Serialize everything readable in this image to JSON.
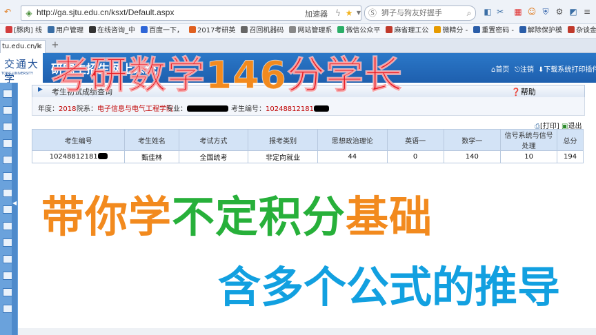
{
  "browser": {
    "url": "http://ga.sjtu.edu.cn/ksxt/Default.aspx",
    "accelerator": "加速器",
    "search_placeholder": "狮子与狗友好握手",
    "bookmarks": [
      {
        "label": "[豚肉] 线",
        "color": "#d23c3c"
      },
      {
        "label": "用户管理",
        "color": "#3a6ea5"
      },
      {
        "label": "在线咨询_中",
        "color": "#333333"
      },
      {
        "label": "百度一下，",
        "color": "#2e66d8"
      },
      {
        "label": "2017考研英",
        "color": "#e06020"
      },
      {
        "label": "召回机器码",
        "color": "#666666"
      },
      {
        "label": "网站管理系",
        "color": "#888888"
      },
      {
        "label": "微信公众平",
        "color": "#2aae67"
      },
      {
        "label": "麻省理工公",
        "color": "#c0392b"
      },
      {
        "label": "微精分 -",
        "color": "#e69b00"
      },
      {
        "label": "重置密码 -",
        "color": "#2a5da8"
      },
      {
        "label": "解除保护模",
        "color": "#2a5da8"
      },
      {
        "label": "杂谈金庸",
        "color": "#c0392b"
      }
    ],
    "tab_label": "tu.edu.cn/k",
    "new_tab": "+"
  },
  "site": {
    "logo_cn": "交通大学",
    "logo_en": "TONG UNIVERSITY",
    "system_name": "研究生招生网上系统",
    "links": {
      "home": "首页",
      "logout": "注销",
      "download": "下载系统打印插件"
    }
  },
  "panel": {
    "title": "考生初试成绩查询",
    "help": "帮助",
    "info": {
      "year_label": "年度：",
      "year": "2018",
      "dept_label": "院系：",
      "dept": "电子信息与电气工程学院",
      "major_label": "专业：",
      "id_label": "考生编号：",
      "id": "10248812181"
    },
    "print": "[打印]",
    "exit": "退出"
  },
  "table": {
    "headers": [
      "考生编号",
      "考生姓名",
      "考试方式",
      "报考类别",
      "思想政治理论",
      "英语一",
      "数学一",
      "信号系统与信号处理",
      "总分"
    ],
    "rows": [
      [
        "10248812181",
        "甄佳林",
        "全国统考",
        "非定向就业",
        "44",
        "0",
        "140",
        "10",
        "194"
      ]
    ]
  },
  "overlay": {
    "headline_a": "考研数学",
    "headline_b": "146",
    "headline_c": "分学长",
    "line2_a": "带你学",
    "line2_b": "不定积分",
    "line2_c": "基础",
    "line3": "含多个公式的推导",
    "colors": {
      "red": "#e81c24",
      "orange": "#f28a1e",
      "green": "#27b03a",
      "blue": "#12a0e0"
    }
  }
}
